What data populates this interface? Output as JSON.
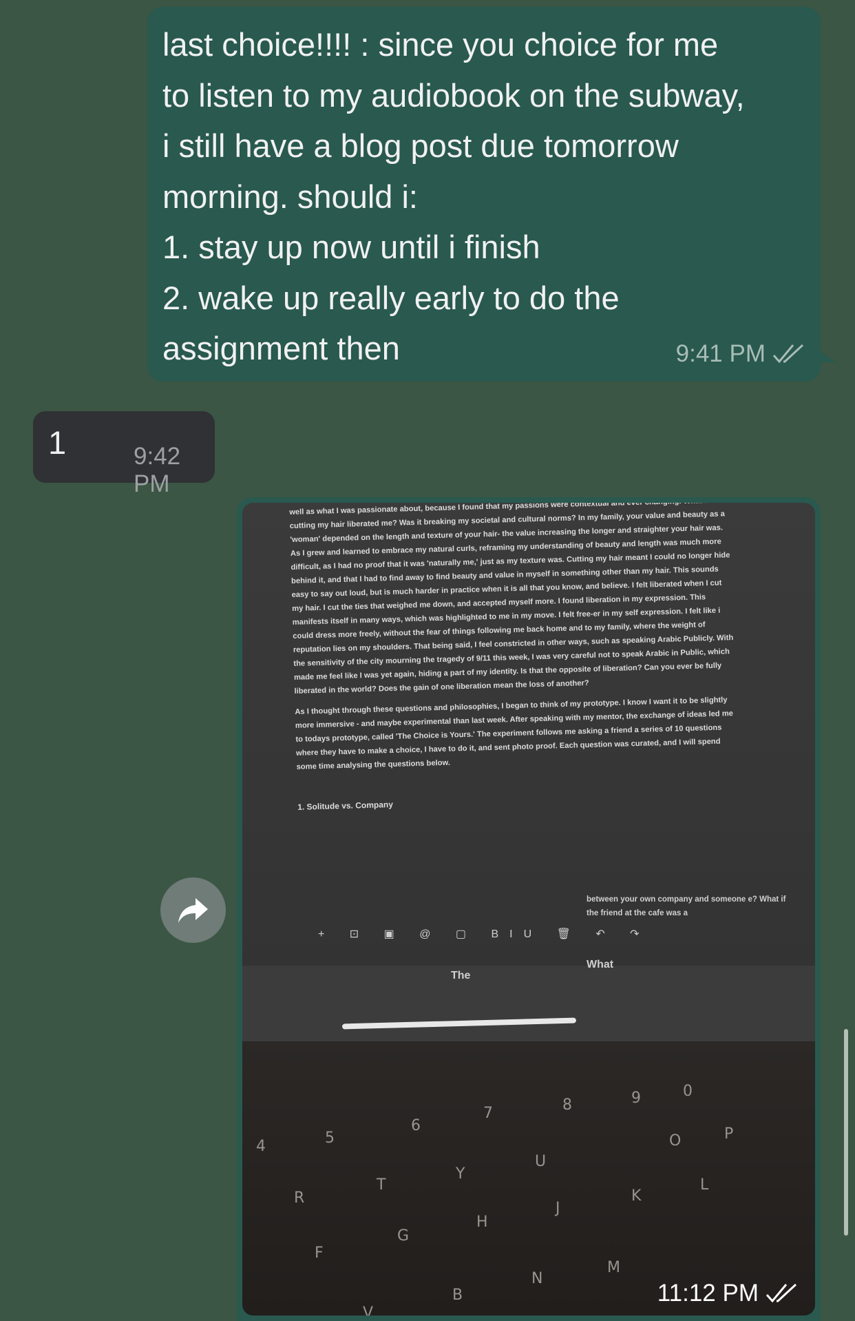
{
  "messages": [
    {
      "text": "last choice!!!! : since you choice for me\nto listen to my audiobook on the subway,\ni still have a blog post due tomorrow\nmorning. should i:\n1. stay up now until i finish\n2. wake up really early to do the\nassignment then",
      "time": "9:41 PM"
    },
    {
      "text": "1",
      "time": "9:42 PM"
    },
    {
      "time": "11:12 PM",
      "photo": {
        "doc_paragraph_1": "well as what I was passionate about, because I found that my passions were contextual and ever changing. What about cutting my hair liberated me? Was it breaking my societal and cultural norms? In my family, your value and beauty as a 'woman' depended on the length and texture of your hair- the value increasing the longer and straighter your hair was. As I grew and learned to embrace my natural curls, reframing my understanding of beauty and length was much more difficult, as I had no proof that it was 'naturally me,' just as my texture was. Cutting my hair meant I could no longer hide behind it, and that I had to find away to find beauty and value in myself in something other than my hair. This sounds easy to say out loud, but is much harder in practice when it is all that you know, and believe. I felt liberated when I cut my hair. I cut the ties that weighed me down, and accepted myself more. I found liberation in my expression. This manifests itself in many ways, which was highlighted to me in my move. I felt free-er in my self expression. I felt like i could dress more freely, without the fear of things following me back home and to my family, where the weight of reputation lies on my shoulders. That being said, I feel constricted in other ways, such as speaking Arabic Publicly. With the sensitivity of the city mourning the tragedy of 9/11 this week, I was very careful not to speak Arabic in Public, which made me feel like I was yet again, hiding a part of my identity. Is that the opposite of liberation? Can you ever be fully liberated in the world? Does the gain of one liberation mean the loss of another?",
        "doc_paragraph_2": "As I thought through these questions and philosophies, I began to think of my prototype. I know I want it to be slightly more immersive - and maybe experimental than last week. After speaking with my mentor, the exchange of ideas led me to todays prototype, called 'The Choice is Yours.' The experiment follows me asking a friend a series of 10 questions where they have to make a choice, I have to do it, and sent photo proof. Each question was curated, and I will spend some time analysing the questions below.",
        "doc_list_item": "1.  Solitude vs. Company",
        "doc_side_note": "between your own company and someone e? What if the friend at the cafe was a",
        "toolbar": "+ ⊡ ▣ @ ▢ BIU 🗑 ↶ ↷",
        "suggestions": [
          "The",
          "What"
        ]
      }
    }
  ],
  "colors": {
    "background": "#3b5644",
    "outgoing_bubble": "#29594f",
    "incoming_bubble": "#2f3134",
    "forward_button": "#6f7c78"
  },
  "icons": [
    "double-check-icon",
    "forward-arrow-icon"
  ]
}
